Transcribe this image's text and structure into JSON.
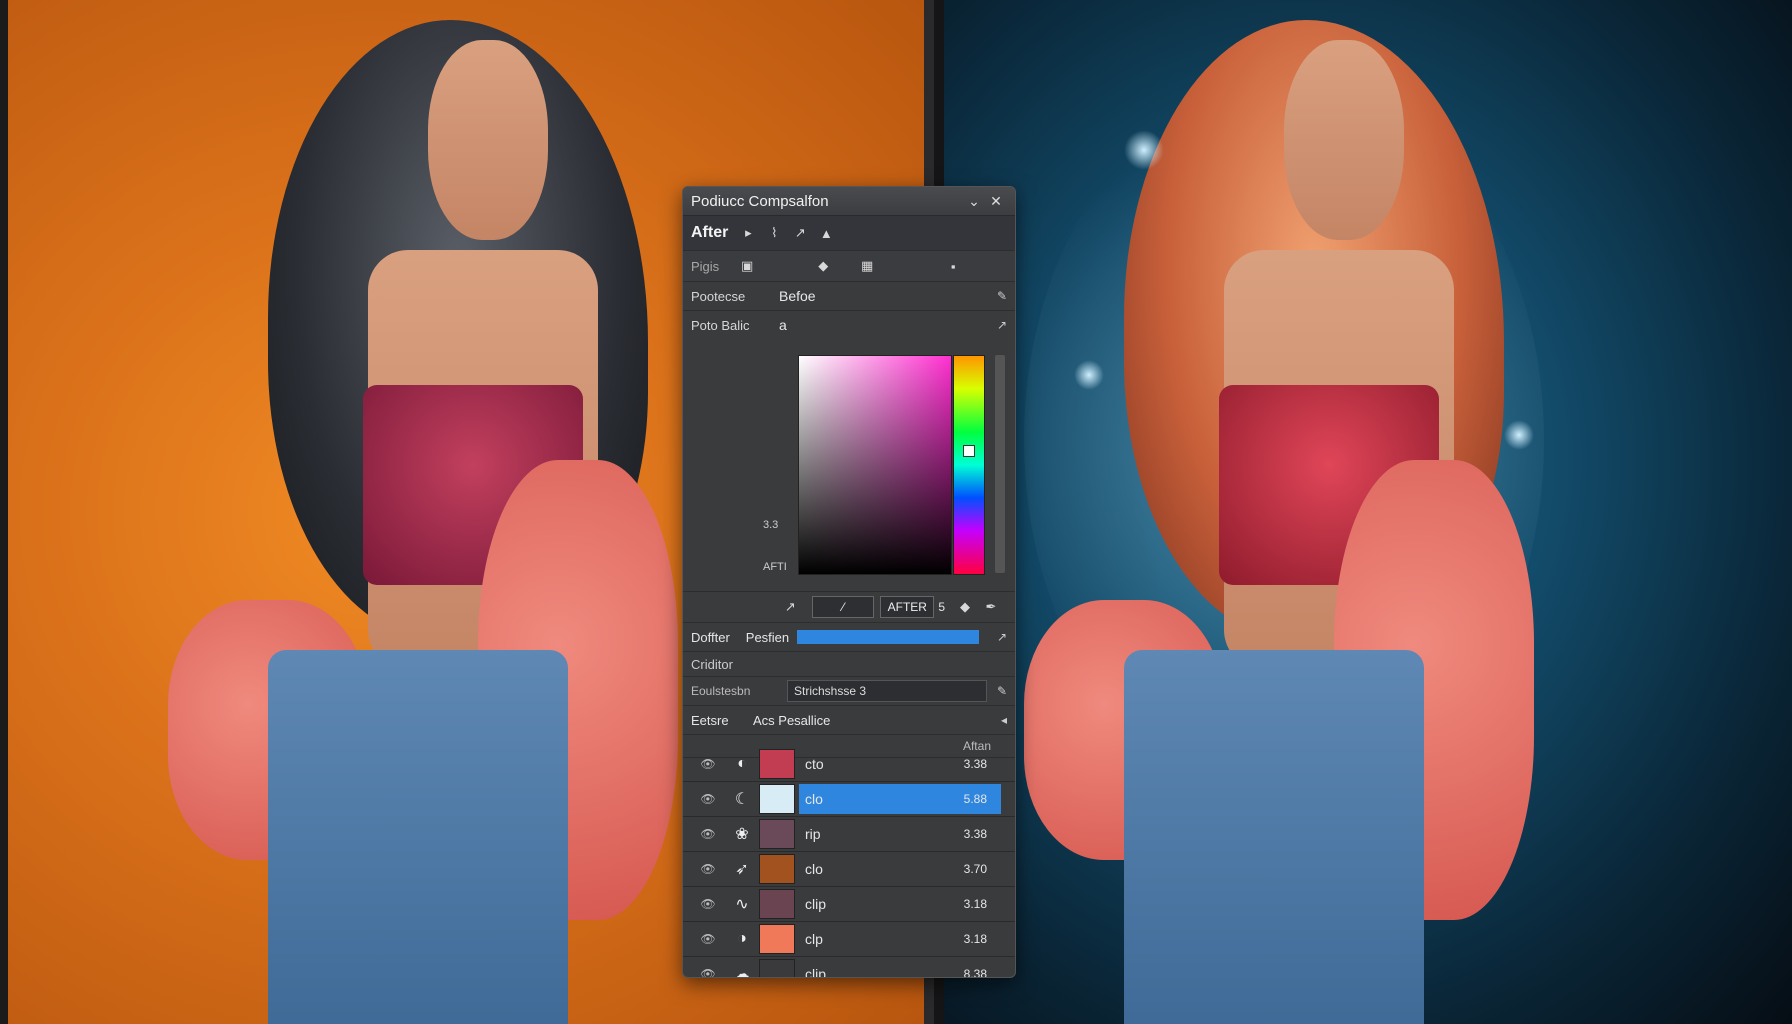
{
  "panel": {
    "title": "Podiucc Compsalfon",
    "toolbar": {
      "mode_label": "After"
    },
    "row2": {
      "label": "Pigis"
    },
    "props": [
      {
        "label": "Pootecse",
        "value": "Befoe"
      },
      {
        "label": "Poto Balic",
        "value": "a"
      }
    ],
    "picker": {
      "value_label": "3.3",
      "mode_label": "AFTI"
    },
    "buttons": {
      "after_label": "AFTER",
      "num_label": "5"
    },
    "rows": {
      "doffter_label": "Doffter",
      "pesfien_label": "Pesfien",
      "progress": 1.0,
      "criditor_label": "Criditor",
      "equal_label": "Eoulstesbn",
      "strichsize_value": "Strichshsse 3",
      "eetsre_label": "Eetsre",
      "acs_value": "Acs Pesallice"
    },
    "layers_header": "Aftan",
    "layers": [
      {
        "name": "cto",
        "value": "3.38",
        "thumb": "#c23d52",
        "selected": false
      },
      {
        "name": "clo",
        "value": "5.88",
        "thumb": "#d8ecf6",
        "selected": true
      },
      {
        "name": "rip",
        "value": "3.38",
        "thumb": "#6a4a58",
        "selected": false
      },
      {
        "name": "clo",
        "value": "3.70",
        "thumb": "#a2521f",
        "selected": false
      },
      {
        "name": "clip",
        "value": "3.18",
        "thumb": "#6b4452",
        "selected": false
      },
      {
        "name": "clp",
        "value": "3.18",
        "thumb": "#f0795a",
        "selected": false
      },
      {
        "name": "clip",
        "value": "8.38",
        "thumb": "#3a3a3c",
        "selected": false
      }
    ]
  },
  "colors": {
    "before_bg": "#e07a1c",
    "after_bg": "#124a68",
    "accent": "#2f86de"
  },
  "icons": [
    "chevron-down-icon",
    "close-icon",
    "play-icon",
    "brush-icon",
    "arrow-icon",
    "grid-icon",
    "eye-icon",
    "pencil-icon",
    "diamond-icon",
    "eyedropper-icon"
  ]
}
